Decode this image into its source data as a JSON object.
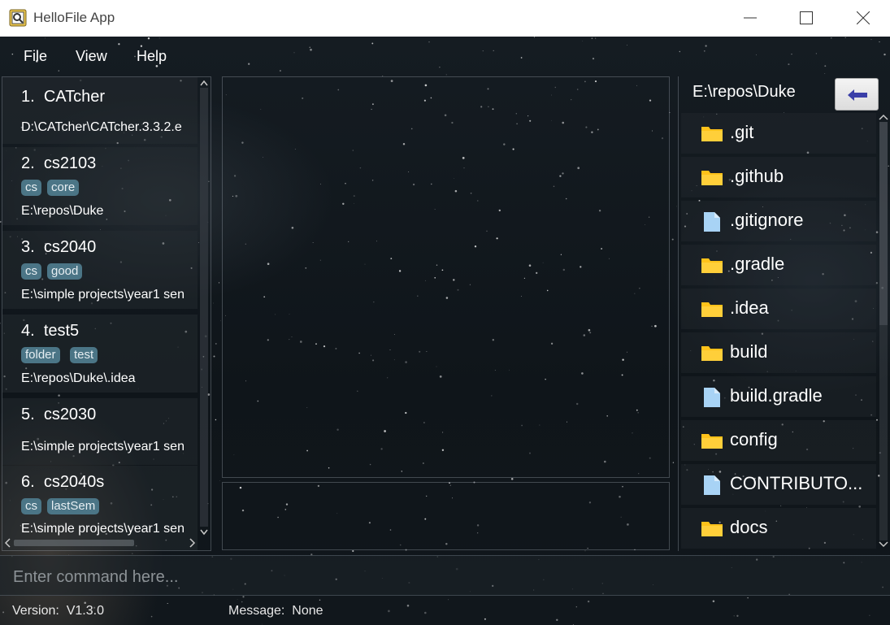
{
  "window": {
    "title": "HelloFile App",
    "minimize_glyph": "—",
    "maximize_glyph": "□",
    "close_glyph": "✕"
  },
  "menu": [
    "File",
    "View",
    "Help"
  ],
  "bookmarks": [
    {
      "index": "1.",
      "name": "CATcher",
      "tags": [],
      "path": "D:\\CATcher\\CATcher.3.3.2.e"
    },
    {
      "index": "2.",
      "name": "cs2103",
      "tags": [
        "cs",
        "core"
      ],
      "path": "E:\\repos\\Duke"
    },
    {
      "index": "3.",
      "name": "cs2040",
      "tags": [
        "cs",
        "good"
      ],
      "path": "E:\\simple projects\\year1 sen"
    },
    {
      "index": "4.",
      "name": "test5",
      "tags": [
        "folder",
        "test"
      ],
      "path": "E:\\repos\\Duke\\.idea"
    },
    {
      "index": "5.",
      "name": "cs2030",
      "tags": [],
      "path": "E:\\simple projects\\year1 sen"
    },
    {
      "index": "6.",
      "name": "cs2040s",
      "tags": [
        "cs",
        "lastSem"
      ],
      "path": "E:\\simple projects\\year1 sen"
    }
  ],
  "explorer": {
    "current_path": "E:\\repos\\Duke",
    "back_icon": "left-arrow-icon",
    "files": [
      {
        "name": ".git",
        "type": "folder"
      },
      {
        "name": ".github",
        "type": "folder"
      },
      {
        "name": ".gitignore",
        "type": "file"
      },
      {
        "name": ".gradle",
        "type": "folder"
      },
      {
        "name": ".idea",
        "type": "folder"
      },
      {
        "name": "build",
        "type": "folder"
      },
      {
        "name": "build.gradle",
        "type": "file"
      },
      {
        "name": "config",
        "type": "folder"
      },
      {
        "name": "CONTRIBUTO...",
        "type": "file"
      },
      {
        "name": "docs",
        "type": "folder"
      }
    ]
  },
  "command": {
    "placeholder": "Enter command here...",
    "value": ""
  },
  "status": {
    "version_label": "Version:",
    "version_value": "V1.3.0",
    "message_label": "Message:",
    "message_value": "None"
  },
  "colors": {
    "tag_bg": "#4b7586",
    "folder": "#ffc21a",
    "file": "#a8d3f5",
    "back_arrow": "#3a3fa8"
  }
}
